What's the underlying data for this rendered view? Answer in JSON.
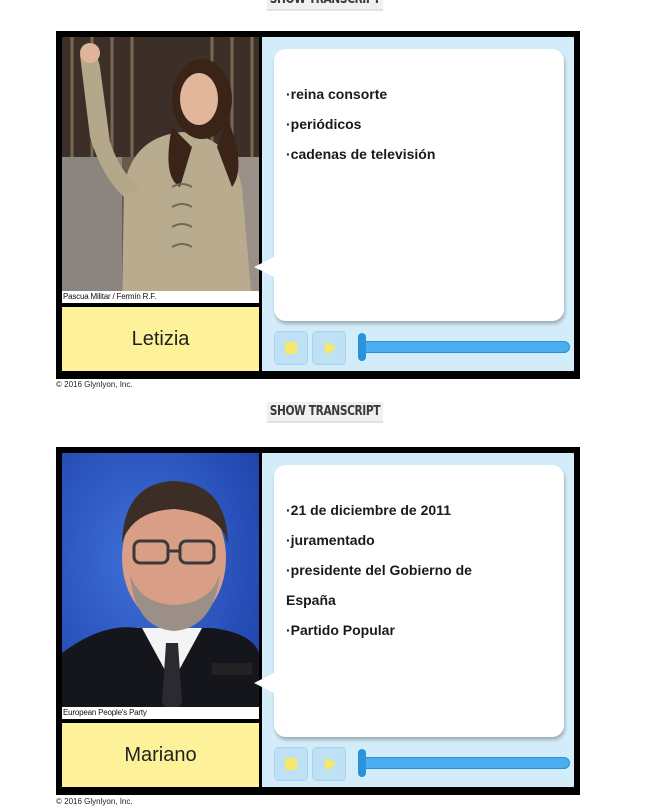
{
  "show_transcript_label": "SHOW TRANSCRIPT",
  "cards": [
    {
      "photo_credit": "Pascua Militar / Fermín R.F.",
      "name": "Letizia",
      "notes": [
        "·reina consorte",
        "·periódicos",
        "·cadenas de televisión"
      ],
      "copyright": "© 2016 Glynlyon, Inc."
    },
    {
      "photo_credit": "European People's Party",
      "name": "Mariano",
      "notes": [
        "·21 de diciembre de 2011",
        "·juramentado",
        "·presidente del Gobierno de",
        "España",
        "·Partido Popular"
      ],
      "copyright": "© 2016 Glynlyon, Inc."
    }
  ],
  "icons": {
    "stop": "stop-icon",
    "play": "play-icon"
  },
  "colors": {
    "name_box": "#fdf29a",
    "panel_bg": "#d3ecf9",
    "slider": "#4aaef0",
    "button_glyph": "#f5e86a"
  }
}
